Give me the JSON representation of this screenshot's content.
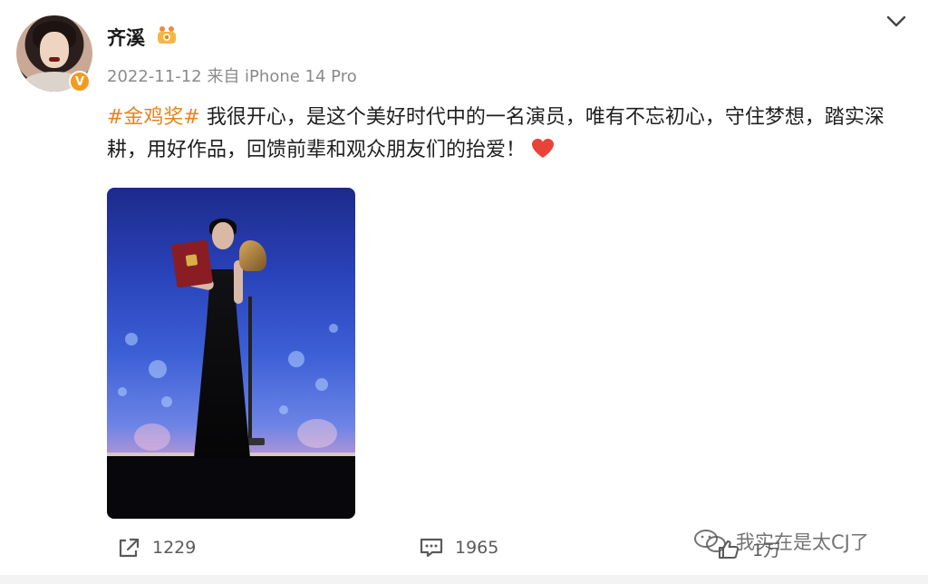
{
  "post": {
    "username": "齐溪",
    "verified_badge": "V",
    "meta": "2022-11-12  来自 iPhone 14 Pro",
    "hashtag": "#金鸡奖#",
    "text": " 我很开心，是这个美好时代中的一名演员，唯有不忘初心，守住梦想，踏实深耕，用好作品，回馈前辈和观众朋友们的抬爱！",
    "colors": {
      "hashtag": "#e8821c",
      "heart": "#e8433a",
      "verified": "#f59a1e"
    }
  },
  "actions": {
    "share_count": "1229",
    "comment_count": "1965",
    "like_count": "1万"
  },
  "watermark": {
    "text": "我实在是太CJ了"
  },
  "icons": {
    "chevron": "chevron-down-icon",
    "crown": "crown-badge-icon",
    "share": "share-icon",
    "comment": "comment-icon",
    "like": "like-icon",
    "heart": "heart-emoji-icon",
    "wechat": "wechat-logo-icon"
  }
}
